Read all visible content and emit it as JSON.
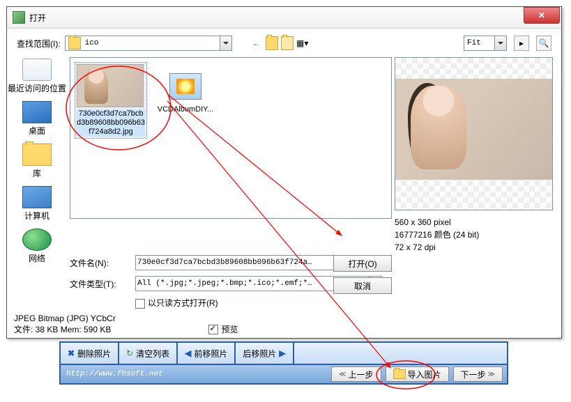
{
  "dialog": {
    "title": "打开",
    "search_label": "查找范围(I):",
    "folder_value": "ico",
    "fit_label": "Fit"
  },
  "places": [
    {
      "label": "最近访问的位置",
      "cls": "pic-recent",
      "name": "place-recent"
    },
    {
      "label": "桌面",
      "cls": "pic-desktop",
      "name": "place-desktop"
    },
    {
      "label": "库",
      "cls": "pic-lib",
      "name": "place-library"
    },
    {
      "label": "计算机",
      "cls": "pic-computer",
      "name": "place-computer"
    },
    {
      "label": "网络",
      "cls": "pic-network",
      "name": "place-network"
    }
  ],
  "files": [
    {
      "caption": "730e0cf3d7ca7bcbd3b89608bb096b63f724a8d2.jpg",
      "selected": true,
      "generic": false
    },
    {
      "caption": "VCDAlbumDIY...",
      "selected": false,
      "generic": true
    }
  ],
  "inputs": {
    "filename_label": "文件名(N):",
    "filename_value": "730e0cf3d7ca7bcbd3b89608bb096b63f724a…",
    "filetype_label": "文件类型(T):",
    "filetype_value": "All (*.jpg;*.jpeg;*.bmp;*.ico;*.emf;*…",
    "readonly_label": "以只读方式打开(R)"
  },
  "buttons": {
    "open": "打开(O)",
    "cancel": "取消"
  },
  "preview": {
    "dim": "560 x 360 pixel",
    "depth": "16777216 颜色 (24 bit)",
    "dpi": "72 x 72 dpi"
  },
  "status": {
    "format": "JPEG Bitmap (JPG) YCbCr",
    "size": "文件: 38 KB   Mem: 590 KB",
    "preview_chk": "预览"
  },
  "backbar": {
    "btn_delete": "删除照片",
    "btn_clear": "清空列表",
    "btn_prevphoto": "前移照片",
    "btn_nextphoto": "后移照片",
    "url": "http://www.fhsoft.net",
    "nav_prev": "上一步",
    "nav_import": "导入图片",
    "nav_next": "下一步"
  }
}
